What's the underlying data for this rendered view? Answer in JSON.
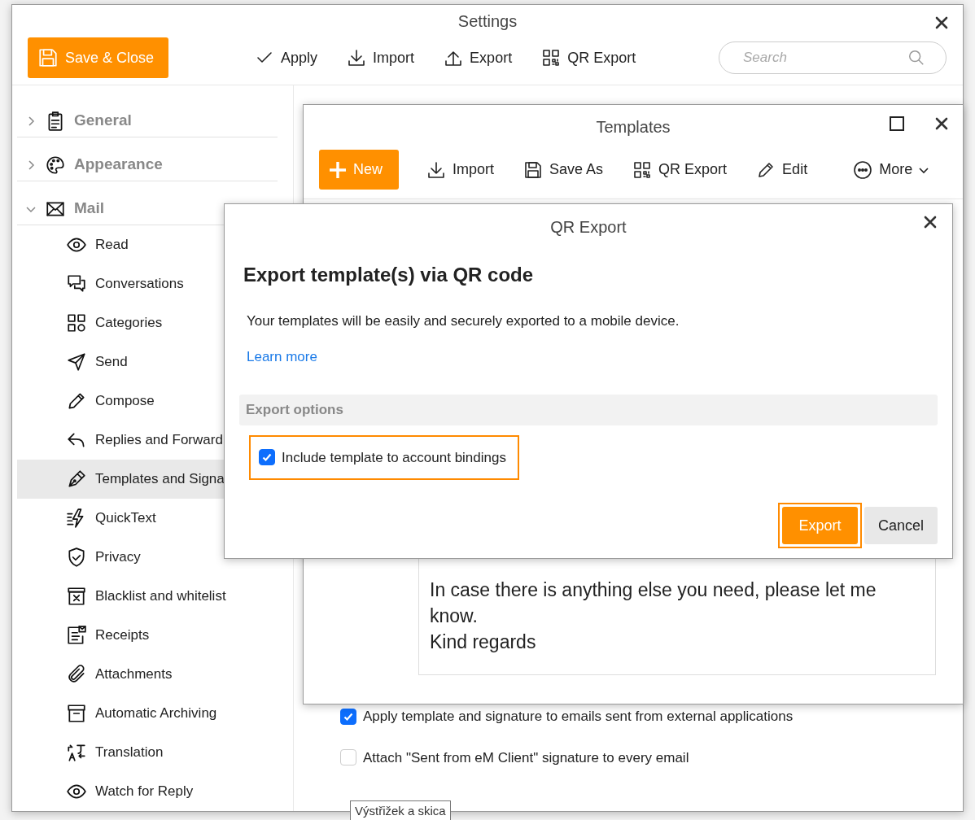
{
  "settings_window": {
    "title": "Settings",
    "save_button": "Save & Close",
    "toolbar": [
      {
        "label": "Apply"
      },
      {
        "label": "Import"
      },
      {
        "label": "Export"
      },
      {
        "label": "QR Export"
      }
    ],
    "search": {
      "placeholder": "Search"
    }
  },
  "sidebar": {
    "sections": [
      {
        "label": "General",
        "expanded": false
      },
      {
        "label": "Appearance",
        "expanded": false
      },
      {
        "label": "Mail",
        "expanded": true,
        "children": [
          {
            "label": "Read",
            "selected": false
          },
          {
            "label": "Conversations",
            "selected": false
          },
          {
            "label": "Categories",
            "selected": false
          },
          {
            "label": "Send",
            "selected": false
          },
          {
            "label": "Compose",
            "selected": false
          },
          {
            "label": "Replies and Forward",
            "selected": false
          },
          {
            "label": "Templates and Signa",
            "selected": true
          },
          {
            "label": "QuickText",
            "selected": false
          },
          {
            "label": "Privacy",
            "selected": false
          },
          {
            "label": "Blacklist and whitelist",
            "selected": false
          },
          {
            "label": "Receipts",
            "selected": false
          },
          {
            "label": "Attachments",
            "selected": false
          },
          {
            "label": "Automatic Archiving",
            "selected": false
          },
          {
            "label": "Translation",
            "selected": false
          },
          {
            "label": "Watch for Reply",
            "selected": false
          }
        ]
      }
    ]
  },
  "options": [
    {
      "label": "Apply template and signature to emails sent from external applications",
      "checked": true
    },
    {
      "label": "Attach \"Sent from eM Client\" signature to every email",
      "checked": false
    }
  ],
  "templates_window": {
    "title": "Templates",
    "new_button": "New",
    "toolbar": [
      {
        "label": "Import"
      },
      {
        "label": "Save As"
      },
      {
        "label": "QR Export"
      },
      {
        "label": "Edit"
      },
      {
        "label": "More"
      }
    ],
    "editor": [
      "In case there is anything else you need, please let me know.",
      "Kind regards"
    ]
  },
  "qr_dialog": {
    "title": "QR Export",
    "heading": "Export template(s) via QR code",
    "description": "Your templates will be easily and securely exported to a mobile device.",
    "link": "Learn more",
    "section": "Export options",
    "option": {
      "label": "Include template to account bindings",
      "checked": true
    },
    "buttons": [
      {
        "label": "Export",
        "kind": "primary"
      },
      {
        "label": "Cancel",
        "kind": "secondary"
      }
    ]
  },
  "tooltip": "Výstřižek a skica"
}
